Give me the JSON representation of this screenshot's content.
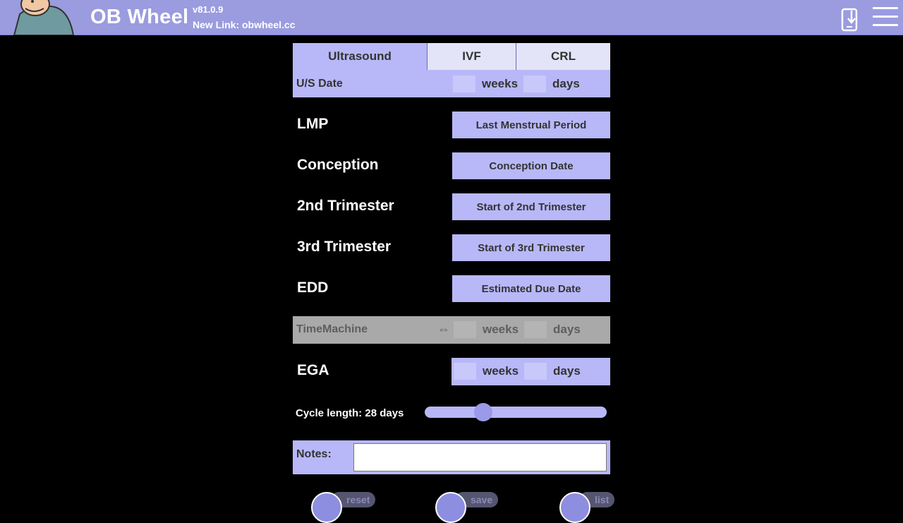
{
  "header": {
    "title": "OB Wheel",
    "version": "v81.0.9",
    "new_link": "New Link: obwheel.cc",
    "icons": [
      "baby-logo",
      "install-app-icon",
      "menu-icon"
    ]
  },
  "tabs": [
    {
      "label": "Ultrasound",
      "active": true
    },
    {
      "label": "IVF",
      "active": false
    },
    {
      "label": "CRL",
      "active": false
    }
  ],
  "us_date": {
    "label": "U/S Date",
    "weeks_unit": "weeks",
    "days_unit": "days",
    "weeks_value": "",
    "days_value": ""
  },
  "dates": [
    {
      "label": "LMP",
      "button": "Last Menstrual Period"
    },
    {
      "label": "Conception",
      "button": "Conception Date"
    },
    {
      "label": "2nd Trimester",
      "button": "Start of 2nd Trimester"
    },
    {
      "label": "3rd Trimester",
      "button": "Start of 3rd Trimester"
    },
    {
      "label": "EDD",
      "button": "Estimated Due Date"
    }
  ],
  "time_machine": {
    "label": "TimeMachine",
    "arrow": "⇔",
    "weeks_unit": "weeks",
    "days_unit": "days"
  },
  "ega": {
    "label": "EGA",
    "weeks_unit": "weeks",
    "days_unit": "days"
  },
  "cycle": {
    "label": "Cycle length: 28 days",
    "value": 28,
    "min": 20,
    "max": 45
  },
  "notes": {
    "label": "Notes:",
    "value": ""
  },
  "footer": {
    "reset": "reset",
    "save": "save",
    "list": "list"
  },
  "colors": {
    "header_bg": "#9b9be0",
    "accent": "#b8b8f8",
    "time_machine_bg": "#a9a9a9"
  }
}
